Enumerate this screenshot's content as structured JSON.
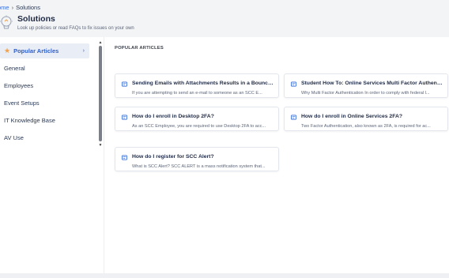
{
  "breadcrumb": {
    "home": "ome",
    "separator": "›",
    "current": "Solutions"
  },
  "header": {
    "icon": "lightbulb-icon",
    "title": "Solutions",
    "subtitle": "Look up policies or read FAQs to fix issues on your own"
  },
  "sidebar": {
    "items": [
      {
        "label": "Popular Articles",
        "icon": "star-icon",
        "active": true,
        "chevron": "›"
      },
      {
        "label": "General"
      },
      {
        "label": "Employees"
      },
      {
        "label": "Event Setups"
      },
      {
        "label": "IT Knowledge Base"
      },
      {
        "label": "AV Use"
      }
    ],
    "scroll_up": "▲",
    "scroll_down": "▼"
  },
  "content": {
    "section_label": "POPULAR ARTICLES",
    "articles": [
      {
        "title": "Sending Emails with Attachments Results in a Bounce b...",
        "desc": "If you are attempting to send an e-mail to someone as an SCC E..."
      },
      {
        "title": "Student How To: Online Services Multi Factor Authentic...",
        "desc": "Why Multi Factor Authentication In order to comply with federal l..."
      },
      {
        "title": "How do I enroll in Desktop 2FA?",
        "desc": "As an SCC Employee, you are required to use Desktop 2FA to acc..."
      },
      {
        "title": "How do I enroll in Online Services 2FA?",
        "desc": "Two Factor Authentication, also known as 2FA, is required for ac..."
      },
      {
        "title": "How do I register for SCC Alert?",
        "desc": "What is SCC Alert? SCC ALERT is a mass notification system that..."
      }
    ]
  },
  "colors": {
    "accent": "#2e5fc9",
    "star": "#f2a14a",
    "link": "#3b6fd8"
  }
}
